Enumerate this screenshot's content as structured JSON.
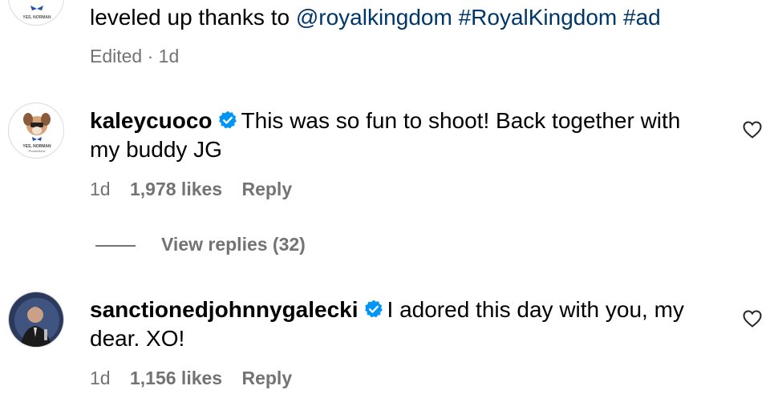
{
  "first_comment": {
    "text_line": "leveled up thanks to ",
    "mention": "@royalkingdom",
    "hashtag1": "#RoyalKingdom",
    "hashtag2": "#ad",
    "meta": "Edited · 1d",
    "avatar_text": "YES, NORMAN"
  },
  "comment_kaley": {
    "username": "kaleycuoco",
    "text_line1": "This was so fun to shoot! Back together with",
    "text_line2": "my buddy JG",
    "time": "1d",
    "likes": "1,978 likes",
    "reply": "Reply",
    "view_replies": "View replies (32)",
    "avatar_text": "YES, NORMAN",
    "avatar_subtext": "Productions"
  },
  "comment_johnny": {
    "username": "sanctionedjohnnygalecki",
    "text_line1": "I adored this day with you, my",
    "text_line2": "dear. XO!",
    "time": "1d",
    "likes": "1,156 likes",
    "reply": "Reply"
  },
  "colors": {
    "link": "#00376b",
    "meta": "#737373",
    "verified": "#0095f6"
  },
  "icons": [
    "heart-icon",
    "verified-badge-icon"
  ]
}
